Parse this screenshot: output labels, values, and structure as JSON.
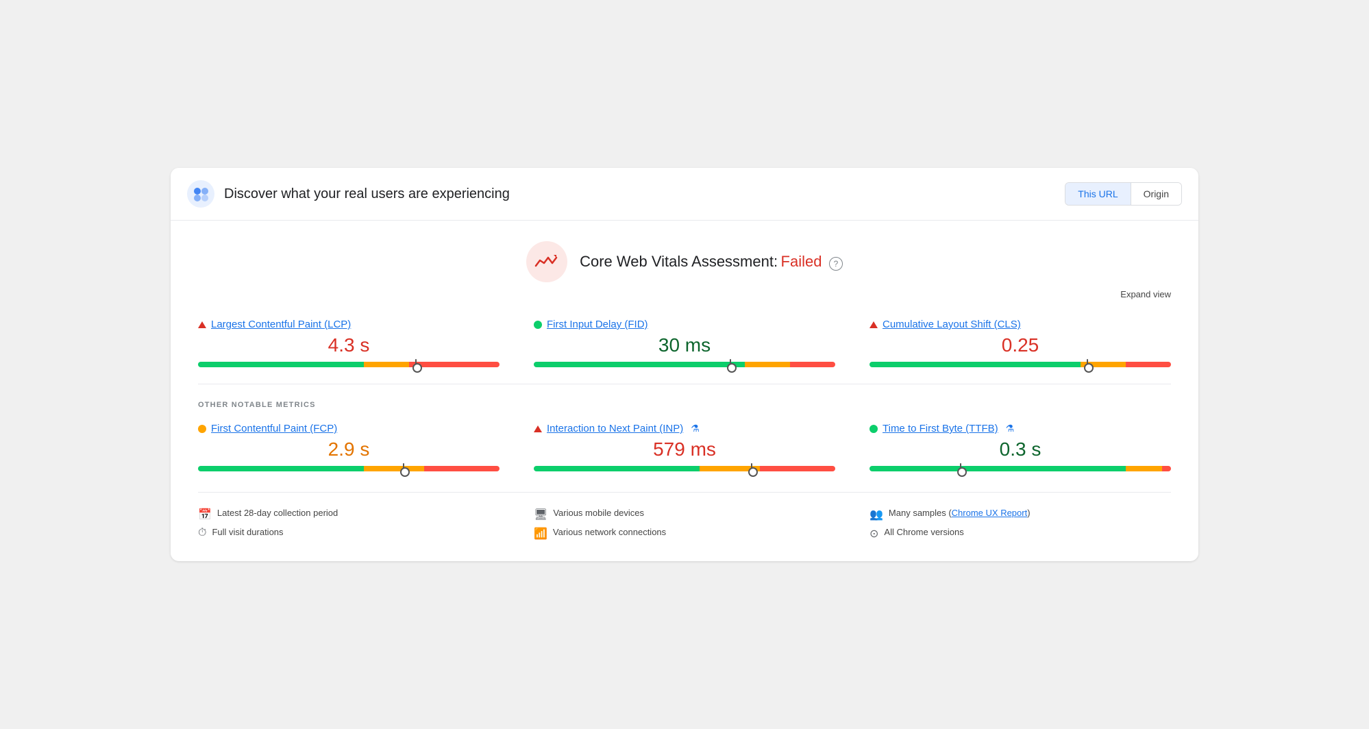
{
  "header": {
    "title": "Discover what your real users are experiencing",
    "buttons": [
      {
        "label": "This URL",
        "active": true
      },
      {
        "label": "Origin",
        "active": false
      }
    ]
  },
  "assessment": {
    "label": "Core Web Vitals Assessment:",
    "status": "Failed",
    "expand_label": "Expand view",
    "help_label": "?"
  },
  "core_metrics": [
    {
      "id": "lcp",
      "title": "Largest Contentful Paint (LCP)",
      "status_type": "triangle",
      "status_color": "red",
      "value": "4.3 s",
      "value_color": "red",
      "bar": {
        "green": 55,
        "orange": 15,
        "red": 30,
        "marker": 72
      }
    },
    {
      "id": "fid",
      "title": "First Input Delay (FID)",
      "status_type": "dot",
      "status_color": "green",
      "value": "30 ms",
      "value_color": "green",
      "bar": {
        "green": 70,
        "orange": 15,
        "red": 15,
        "marker": 65
      }
    },
    {
      "id": "cls",
      "title": "Cumulative Layout Shift (CLS)",
      "status_type": "triangle",
      "status_color": "red",
      "value": "0.25",
      "value_color": "red",
      "bar": {
        "green": 70,
        "orange": 15,
        "red": 15,
        "marker": 72
      }
    }
  ],
  "other_metrics_label": "OTHER NOTABLE METRICS",
  "other_metrics": [
    {
      "id": "fcp",
      "title": "First Contentful Paint (FCP)",
      "status_type": "dot",
      "status_color": "orange",
      "has_flask": false,
      "value": "2.9 s",
      "value_color": "orange",
      "bar": {
        "green": 55,
        "orange": 20,
        "red": 25,
        "marker": 68
      }
    },
    {
      "id": "inp",
      "title": "Interaction to Next Paint (INP)",
      "status_type": "triangle",
      "status_color": "red",
      "has_flask": true,
      "value": "579 ms",
      "value_color": "red",
      "bar": {
        "green": 55,
        "orange": 20,
        "red": 25,
        "marker": 72
      }
    },
    {
      "id": "ttfb",
      "title": "Time to First Byte (TTFB)",
      "status_type": "dot",
      "status_color": "green",
      "has_flask": true,
      "value": "0.3 s",
      "value_color": "green",
      "bar": {
        "green": 85,
        "orange": 12,
        "red": 3,
        "marker": 30
      }
    }
  ],
  "footer": [
    [
      {
        "icon": "📅",
        "text": "Latest 28-day collection period"
      },
      {
        "icon": "⏱",
        "text": "Full visit durations"
      }
    ],
    [
      {
        "icon": "🖥",
        "text": "Various mobile devices"
      },
      {
        "icon": "📶",
        "text": "Various network connections"
      }
    ],
    [
      {
        "icon": "👥",
        "text_before": "Many samples (",
        "link": "Chrome UX Report",
        "text_after": ")"
      },
      {
        "icon": "⊙",
        "text": "All Chrome versions"
      }
    ]
  ]
}
